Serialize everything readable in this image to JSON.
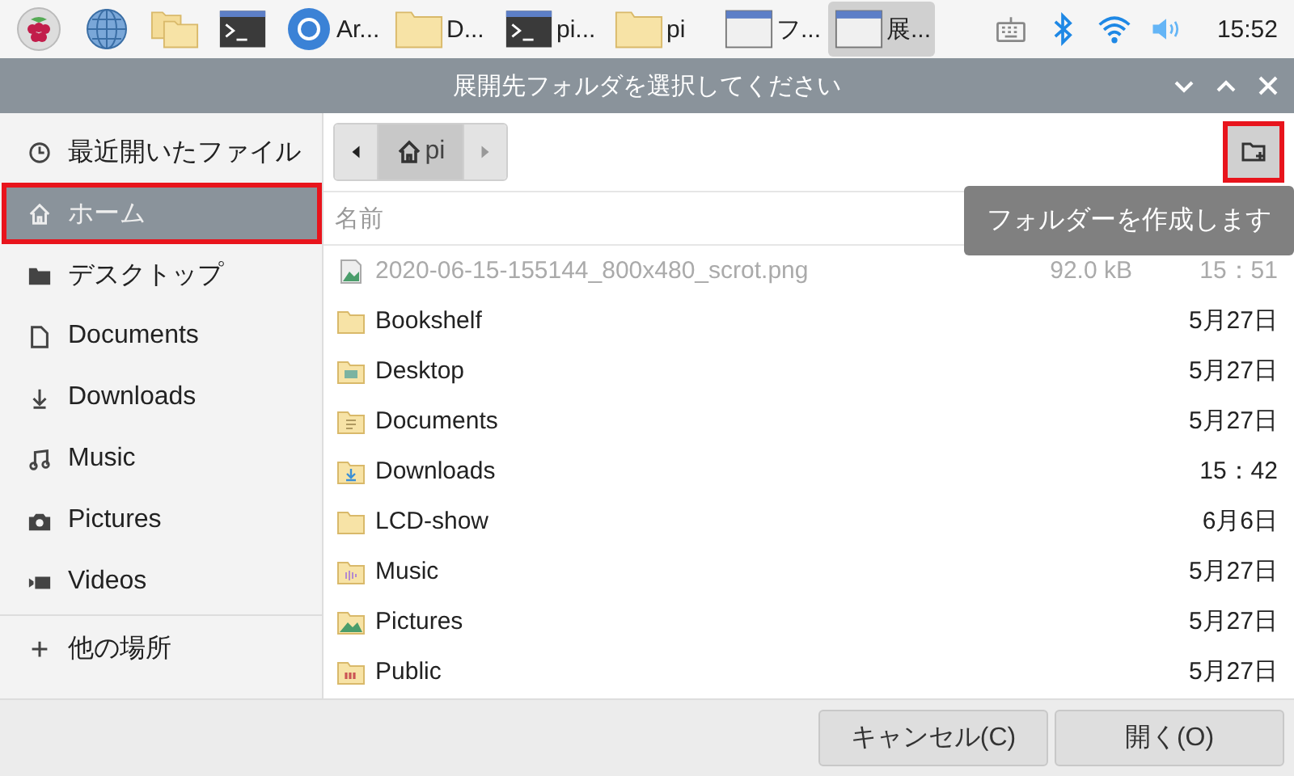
{
  "taskbar": {
    "launchers": [
      {
        "kind": "raspberry"
      },
      {
        "kind": "globe"
      },
      {
        "kind": "folders"
      },
      {
        "kind": "terminal"
      }
    ],
    "tasks": [
      {
        "kind": "chrome",
        "label": "Ar...",
        "selected": false
      },
      {
        "kind": "folder",
        "label": "D...",
        "selected": false
      },
      {
        "kind": "terminal",
        "label": "pi...",
        "selected": false
      },
      {
        "kind": "folder",
        "label": "pi",
        "selected": false
      },
      {
        "kind": "window",
        "label": "フ...",
        "selected": false
      },
      {
        "kind": "window",
        "label": "展...",
        "selected": true
      }
    ],
    "tray": [
      {
        "kind": "keyboard"
      },
      {
        "kind": "bluetooth"
      },
      {
        "kind": "wifi"
      },
      {
        "kind": "volume"
      }
    ],
    "clock": "15:52"
  },
  "window": {
    "title": "展開先フォルダを選択してください"
  },
  "sidebar": {
    "items": [
      {
        "kind": "recent",
        "label": "最近開いたファイル",
        "selected": false,
        "highlighted": false
      },
      {
        "kind": "home",
        "label": "ホーム",
        "selected": true,
        "highlighted": true
      },
      {
        "kind": "desktop",
        "label": "デスクトップ",
        "selected": false,
        "highlighted": false
      },
      {
        "kind": "document",
        "label": "Documents",
        "selected": false,
        "highlighted": false
      },
      {
        "kind": "download",
        "label": "Downloads",
        "selected": false,
        "highlighted": false
      },
      {
        "kind": "music",
        "label": "Music",
        "selected": false,
        "highlighted": false
      },
      {
        "kind": "camera",
        "label": "Pictures",
        "selected": false,
        "highlighted": false
      },
      {
        "kind": "video",
        "label": "Videos",
        "selected": false,
        "highlighted": false
      }
    ],
    "other": {
      "label": "他の場所"
    }
  },
  "path_bar": {
    "segments": [
      {
        "label": "pi",
        "selected": true
      }
    ]
  },
  "new_folder_button": {
    "highlighted": true,
    "tooltip": "フォルダーを作成します"
  },
  "table": {
    "columns": [
      "名前"
    ],
    "rows": [
      {
        "kind": "image",
        "name": "2020-06-15-155144_800x480_scrot.png",
        "size": "92.0 kB",
        "modified": "15：51",
        "dimmed": true
      },
      {
        "kind": "folder",
        "name": "Bookshelf",
        "modified": "5月27日",
        "dimmed": false
      },
      {
        "kind": "desktop",
        "name": "Desktop",
        "modified": "5月27日",
        "dimmed": false
      },
      {
        "kind": "documents",
        "name": "Documents",
        "modified": "5月27日",
        "dimmed": false
      },
      {
        "kind": "downloads",
        "name": "Downloads",
        "modified": "15：42",
        "dimmed": false
      },
      {
        "kind": "folder",
        "name": "LCD-show",
        "modified": "6月6日",
        "dimmed": false
      },
      {
        "kind": "music",
        "name": "Music",
        "modified": "5月27日",
        "dimmed": false
      },
      {
        "kind": "pictures",
        "name": "Pictures",
        "modified": "5月27日",
        "dimmed": false
      },
      {
        "kind": "public",
        "name": "Public",
        "modified": "5月27日",
        "dimmed": false
      }
    ]
  },
  "buttons": [
    {
      "label": "キャンセル(C)"
    },
    {
      "label": "開く(O)"
    }
  ]
}
